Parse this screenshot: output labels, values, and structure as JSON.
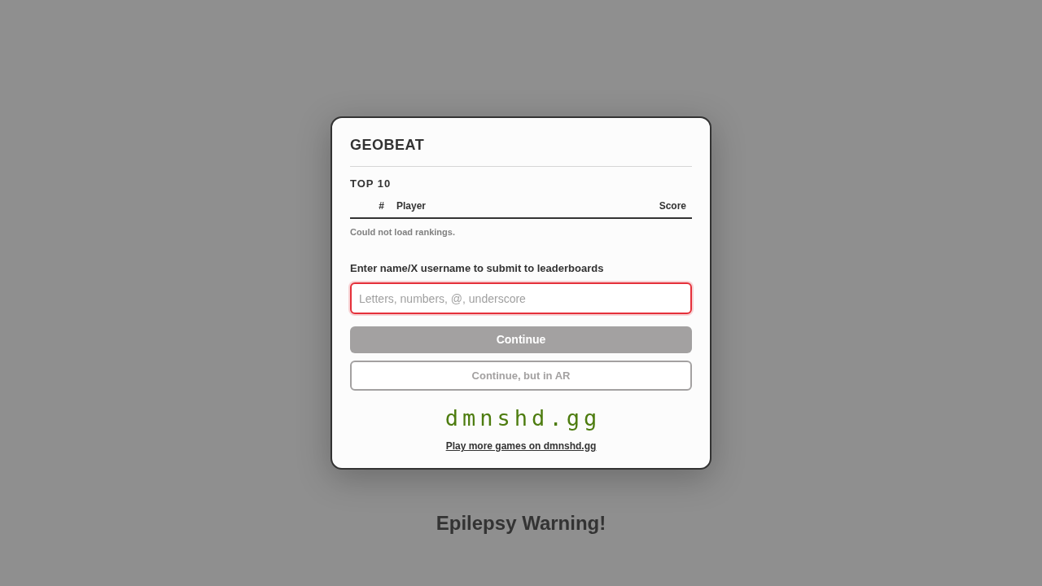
{
  "dialog": {
    "title": "GEOBEAT",
    "leaderboard": {
      "heading": "TOP 10",
      "columns": [
        "#",
        "Player",
        "Score"
      ],
      "message": "Could not load rankings."
    },
    "name_field": {
      "label": "Enter name/X username to submit to leaderboards",
      "placeholder": "Letters, numbers, @, underscore",
      "invalid": true
    },
    "buttons": [
      {
        "label": "Continue",
        "kind": "primary",
        "disabled": true
      },
      {
        "label": "Continue, but in AR",
        "kind": "outline",
        "disabled": true
      }
    ],
    "logo": "dmnshd.gg",
    "link": "Play more games on dmnshd.gg"
  },
  "warning": "Epilepsy Warning!"
}
